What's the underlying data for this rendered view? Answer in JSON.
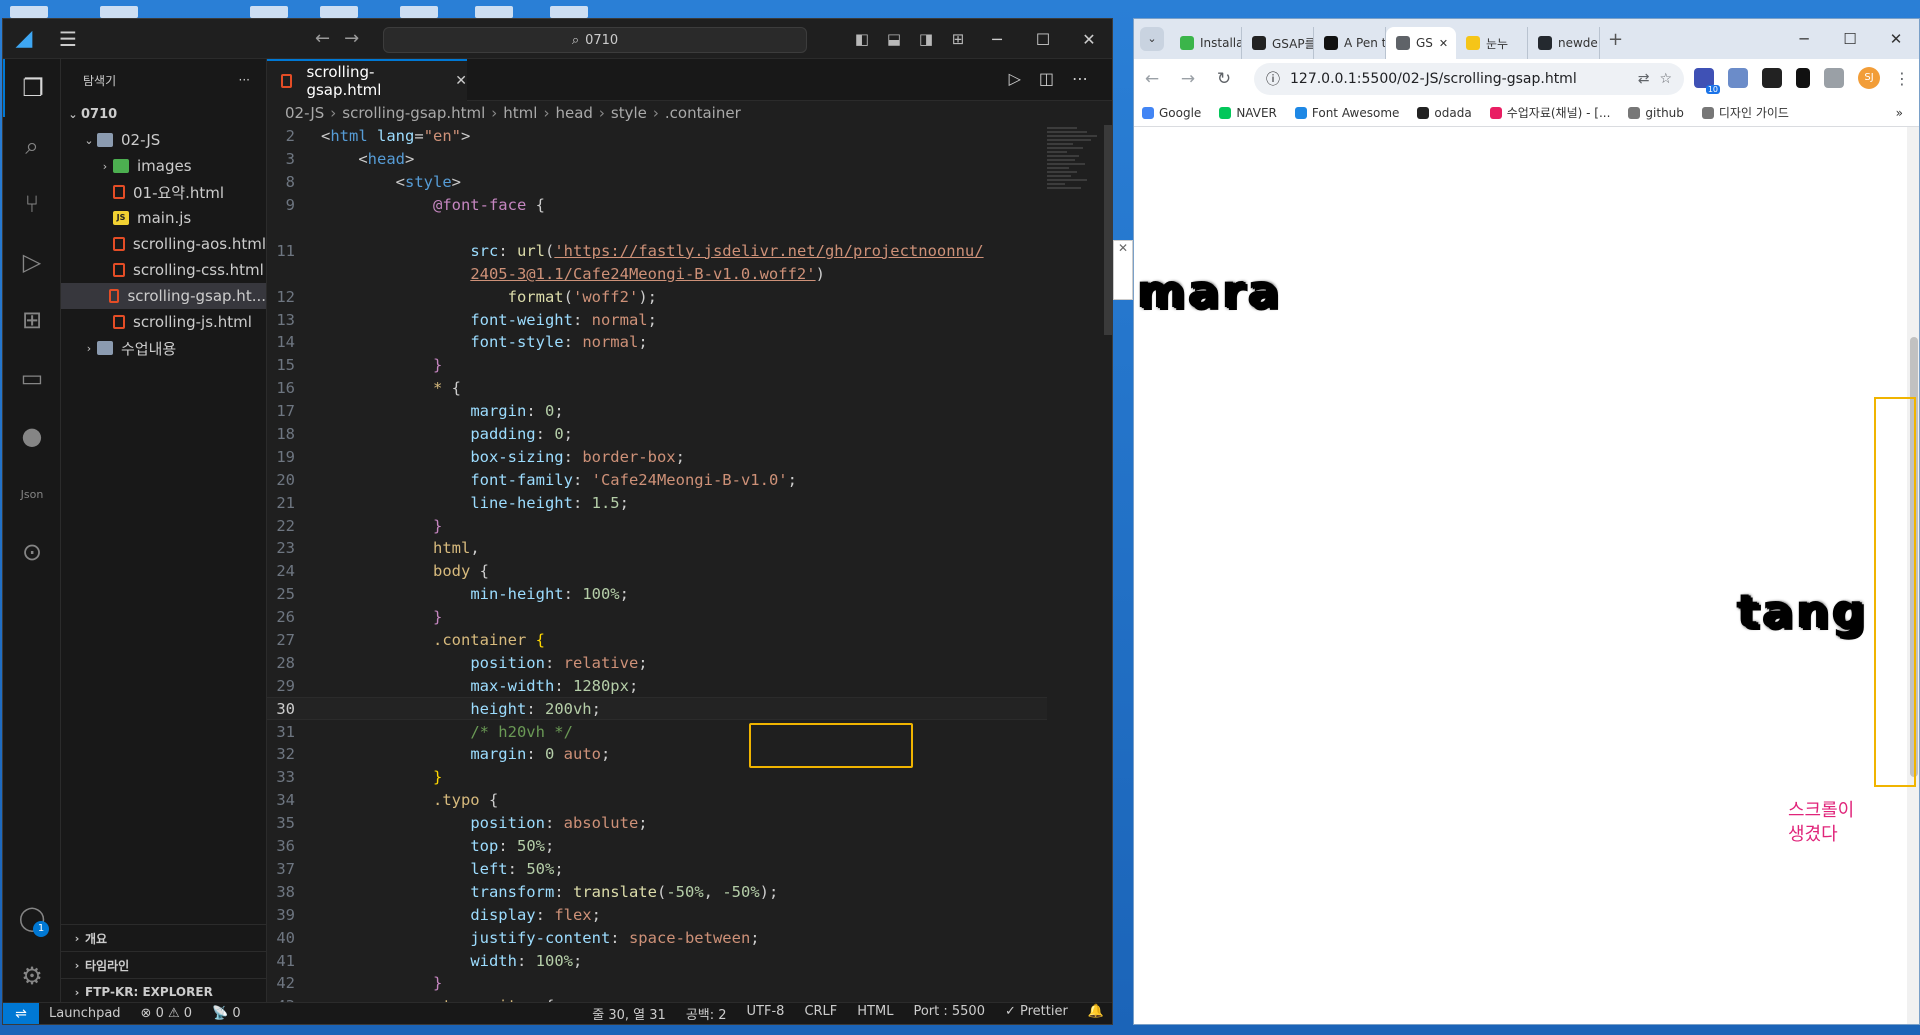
{
  "vscode": {
    "search_text": "0710",
    "explorer_title": "탐색기",
    "root_folder": "0710",
    "tree": [
      {
        "label": "02-JS",
        "type": "folder-open",
        "indent": 1
      },
      {
        "label": "images",
        "type": "img-folder",
        "indent": 2
      },
      {
        "label": "01-요약.html",
        "type": "html",
        "indent": 2
      },
      {
        "label": "main.js",
        "type": "js",
        "indent": 2
      },
      {
        "label": "scrolling-aos.html",
        "type": "html",
        "indent": 2
      },
      {
        "label": "scrolling-css.html",
        "type": "html",
        "indent": 2
      },
      {
        "label": "scrolling-gsap.ht...",
        "type": "html",
        "indent": 2,
        "selected": true
      },
      {
        "label": "scrolling-js.html",
        "type": "html",
        "indent": 2
      },
      {
        "label": "수업내용",
        "type": "folder",
        "indent": 1
      }
    ],
    "bottom_sections": [
      "개요",
      "타임라인",
      "FTP-KR: EXPLORER"
    ],
    "tab_label": "scrolling-gsap.html",
    "breadcrumb": [
      "02-JS",
      "scrolling-gsap.html",
      "html",
      "head",
      "style",
      ".container"
    ],
    "line_numbers": [
      "2",
      "3",
      "8",
      "9",
      "",
      "11",
      "",
      "12",
      "13",
      "14",
      "15",
      "16",
      "17",
      "18",
      "19",
      "20",
      "21",
      "22",
      "23",
      "24",
      "25",
      "26",
      "27",
      "28",
      "29",
      "30",
      "31",
      "32",
      "33",
      "34",
      "35",
      "36",
      "37",
      "38",
      "39",
      "40",
      "41",
      "42",
      "43"
    ],
    "status": {
      "launchpad": "Launchpad",
      "problems": "⊗ 0 ⚠ 0",
      "ports": "📡 0",
      "position": "줄 30, 열 31",
      "spaces": "공백: 2",
      "encoding": "UTF-8",
      "eol": "CRLF",
      "language": "HTML",
      "port": "Port : 5500",
      "prettier": "✓ Prettier"
    },
    "account_badge": "1"
  },
  "chrome": {
    "tabs": [
      {
        "label": "Installa",
        "color": "#3bb54a"
      },
      {
        "label": "GSAP를",
        "color": "#222222"
      },
      {
        "label": "A Pen t",
        "color": "#111111"
      },
      {
        "label": "GS",
        "color": "#5f6368",
        "active": true
      },
      {
        "label": "눈누",
        "color": "#f5c518"
      },
      {
        "label": "newde",
        "color": "#24292f"
      }
    ],
    "url": "127.0.0.1:5500/02-JS/scrolling-gsap.html",
    "bookmarks": [
      "Google",
      "NAVER",
      "Font Awesome",
      "odada",
      "수업자료(채널) - [...",
      "github",
      "디자인 가이드"
    ],
    "avatar": "SJ",
    "ext_badge": "10",
    "page": {
      "word_left": "mara",
      "word_right": "tang",
      "note": "스크롤이\n생겼다"
    }
  }
}
